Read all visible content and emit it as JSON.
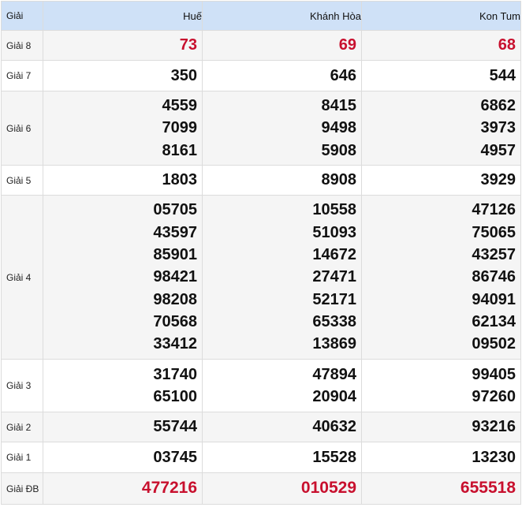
{
  "header": {
    "label": "Giải",
    "provinces": [
      "Huế",
      "Khánh Hòa",
      "Kon Tum"
    ]
  },
  "rows": [
    {
      "label": "Giải 8",
      "values": [
        [
          "73"
        ],
        [
          "69"
        ],
        [
          "68"
        ]
      ],
      "highlight": true
    },
    {
      "label": "Giải 7",
      "values": [
        [
          "350"
        ],
        [
          "646"
        ],
        [
          "544"
        ]
      ],
      "highlight": false
    },
    {
      "label": "Giải 6",
      "values": [
        [
          "4559",
          "7099",
          "8161"
        ],
        [
          "8415",
          "9498",
          "5908"
        ],
        [
          "6862",
          "3973",
          "4957"
        ]
      ],
      "highlight": false
    },
    {
      "label": "Giải 5",
      "values": [
        [
          "1803"
        ],
        [
          "8908"
        ],
        [
          "3929"
        ]
      ],
      "highlight": false
    },
    {
      "label": "Giải 4",
      "values": [
        [
          "05705",
          "43597",
          "85901",
          "98421",
          "98208",
          "70568",
          "33412"
        ],
        [
          "10558",
          "51093",
          "14672",
          "27471",
          "52171",
          "65338",
          "13869"
        ],
        [
          "47126",
          "75065",
          "43257",
          "86746",
          "94091",
          "62134",
          "09502"
        ]
      ],
      "highlight": false
    },
    {
      "label": "Giải 3",
      "values": [
        [
          "31740",
          "65100"
        ],
        [
          "47894",
          "20904"
        ],
        [
          "99405",
          "97260"
        ]
      ],
      "highlight": false
    },
    {
      "label": "Giải 2",
      "values": [
        [
          "55744"
        ],
        [
          "40632"
        ],
        [
          "93216"
        ]
      ],
      "highlight": false
    },
    {
      "label": "Giải 1",
      "values": [
        [
          "03745"
        ],
        [
          "15528"
        ],
        [
          "13230"
        ]
      ],
      "highlight": false
    },
    {
      "label": "Giải ĐB",
      "values": [
        [
          "477216"
        ],
        [
          "010529"
        ],
        [
          "655518"
        ]
      ],
      "highlight": true
    }
  ],
  "colors": {
    "header_bg": "#cfe1f7",
    "highlight": "#c8102e",
    "stripe": "#f5f5f5"
  }
}
